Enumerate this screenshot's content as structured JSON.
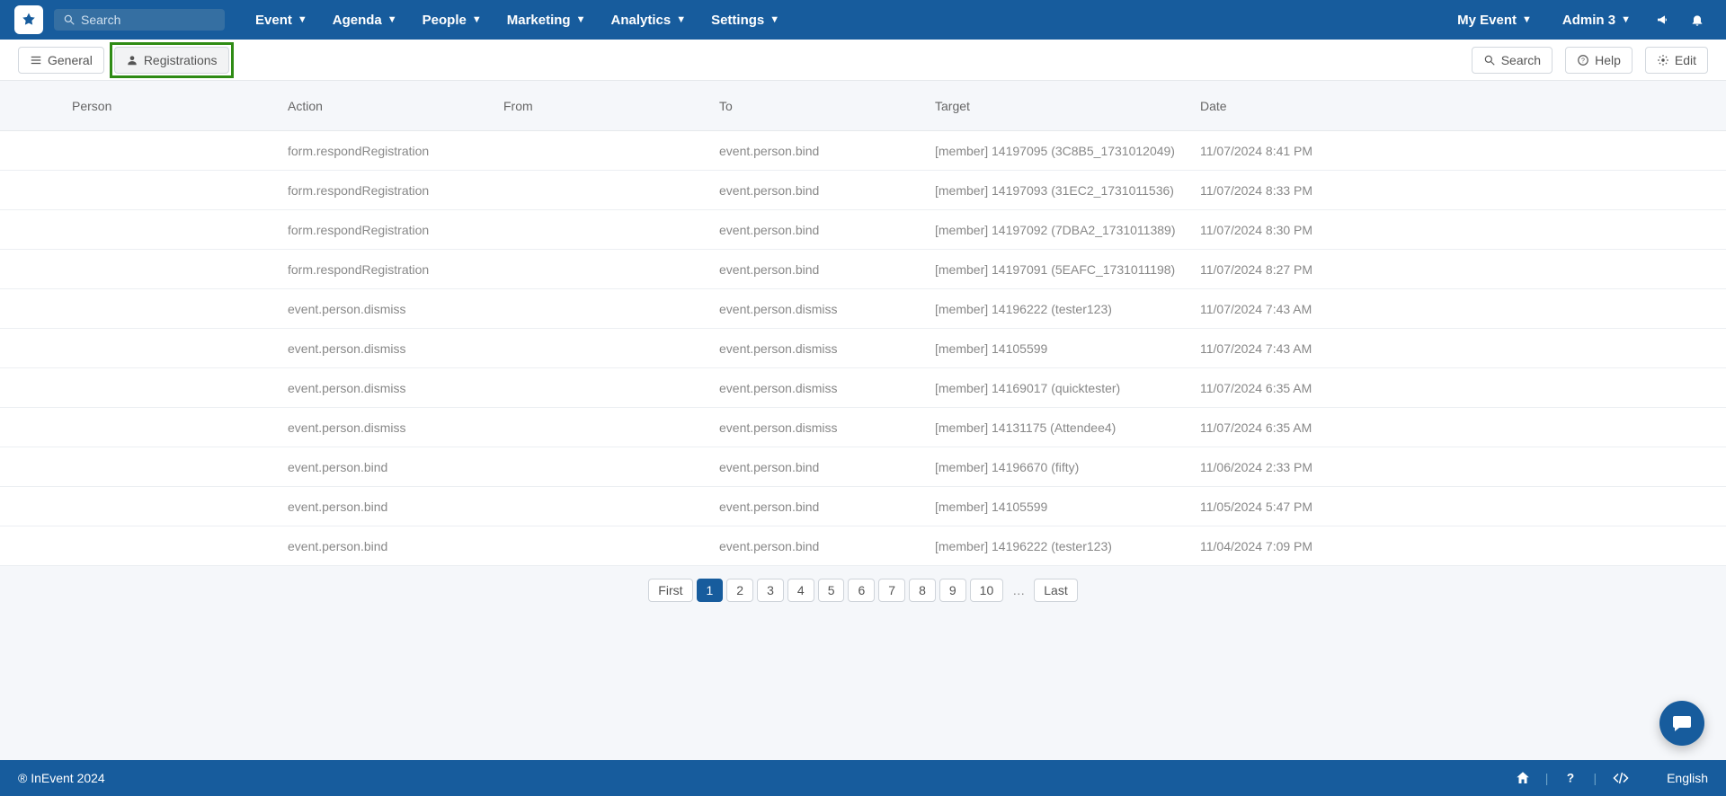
{
  "header": {
    "search_placeholder": "Search",
    "menu": [
      "Event",
      "Agenda",
      "People",
      "Marketing",
      "Analytics",
      "Settings"
    ],
    "right": {
      "event_label": "My Event",
      "user_label": "Admin 3"
    }
  },
  "subheader": {
    "tabs": {
      "general": "General",
      "registrations": "Registrations"
    },
    "actions": {
      "search": "Search",
      "help": "Help",
      "edit": "Edit"
    }
  },
  "table": {
    "headers": [
      "Person",
      "Action",
      "From",
      "To",
      "Target",
      "Date"
    ],
    "rows": [
      {
        "person": "",
        "action": "form.respondRegistration",
        "from": "",
        "to": "event.person.bind",
        "target": "[member] 14197095 (3C8B5_1731012049)",
        "date": "11/07/2024 8:41 PM"
      },
      {
        "person": "",
        "action": "form.respondRegistration",
        "from": "",
        "to": "event.person.bind",
        "target": "[member] 14197093 (31EC2_1731011536)",
        "date": "11/07/2024 8:33 PM"
      },
      {
        "person": "",
        "action": "form.respondRegistration",
        "from": "",
        "to": "event.person.bind",
        "target": "[member] 14197092 (7DBA2_1731011389)",
        "date": "11/07/2024 8:30 PM"
      },
      {
        "person": "",
        "action": "form.respondRegistration",
        "from": "",
        "to": "event.person.bind",
        "target": "[member] 14197091 (5EAFC_1731011198)",
        "date": "11/07/2024 8:27 PM"
      },
      {
        "person": "",
        "action": "event.person.dismiss",
        "from": "",
        "to": "event.person.dismiss",
        "target": "[member] 14196222 (tester123)",
        "date": "11/07/2024 7:43 AM"
      },
      {
        "person": "",
        "action": "event.person.dismiss",
        "from": "",
        "to": "event.person.dismiss",
        "target": "[member] 14105599",
        "date": "11/07/2024 7:43 AM"
      },
      {
        "person": "",
        "action": "event.person.dismiss",
        "from": "",
        "to": "event.person.dismiss",
        "target": "[member] 14169017 (quicktester)",
        "date": "11/07/2024 6:35 AM"
      },
      {
        "person": "",
        "action": "event.person.dismiss",
        "from": "",
        "to": "event.person.dismiss",
        "target": "[member] 14131175 (Attendee4)",
        "date": "11/07/2024 6:35 AM"
      },
      {
        "person": "",
        "action": "event.person.bind",
        "from": "",
        "to": "event.person.bind",
        "target": "[member] 14196670 (fifty)",
        "date": "11/06/2024 2:33 PM"
      },
      {
        "person": "",
        "action": "event.person.bind",
        "from": "",
        "to": "event.person.bind",
        "target": "[member] 14105599",
        "date": "11/05/2024 5:47 PM"
      },
      {
        "person": "",
        "action": "event.person.bind",
        "from": "",
        "to": "event.person.bind",
        "target": "[member] 14196222 (tester123)",
        "date": "11/04/2024 7:09 PM"
      }
    ]
  },
  "pagination": {
    "first": "First",
    "pages": [
      "1",
      "2",
      "3",
      "4",
      "5",
      "6",
      "7",
      "8",
      "9",
      "10"
    ],
    "ellipsis": "…",
    "last": "Last",
    "active": "1"
  },
  "footer": {
    "copyright": "® InEvent 2024",
    "language": "English"
  }
}
